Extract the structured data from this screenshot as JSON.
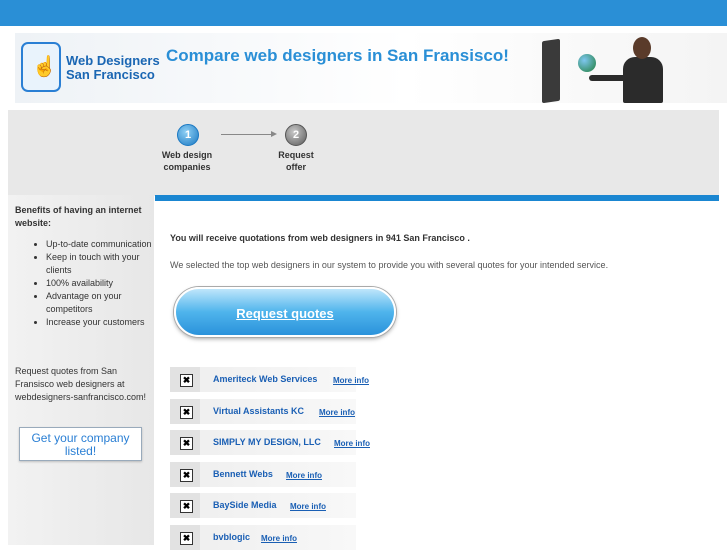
{
  "header": {
    "logo_line1": "Web Designers",
    "logo_line2": "San Francisco",
    "title": "Compare web designers in San Fransisco!"
  },
  "steps": [
    {
      "number": "1",
      "label": "Web design companies",
      "state": "active"
    },
    {
      "number": "2",
      "label": "Request offer",
      "state": "inactive"
    }
  ],
  "sidebar": {
    "heading": "Benefits of having an internet website:",
    "benefits": [
      "Up-to-date communication",
      "Keep in touch with your clients",
      "100% availability",
      "Advantage on your competitors",
      "Increase your customers"
    ],
    "note": "Request quotes from San Fransisco web designers at webdesigners-sanfrancisco.com!",
    "company_button": "Get your company listed!"
  },
  "main": {
    "intro_bold": "You will receive quotations from web designers in 941 San Francisco .",
    "intro_text": "We selected the top web designers in our system to provide you with several quotes for your intended service.",
    "request_button": "Request quotes",
    "companies": [
      {
        "name": "Ameriteck Web Services",
        "more": "More info",
        "checked": true
      },
      {
        "name": "Virtual Assistants KC",
        "more": "More info",
        "checked": true
      },
      {
        "name": "SIMPLY MY DESIGN, LLC",
        "more": "More info",
        "checked": true
      },
      {
        "name": "Bennett Webs",
        "more": "More info",
        "checked": true
      },
      {
        "name": "BaySide Media",
        "more": "More info",
        "checked": true
      },
      {
        "name": "bvblogic",
        "more": "More info",
        "checked": true
      }
    ]
  },
  "colors": {
    "accent": "#2a8fd6",
    "link": "#1a5fb4",
    "band": "#e8e8e8"
  }
}
